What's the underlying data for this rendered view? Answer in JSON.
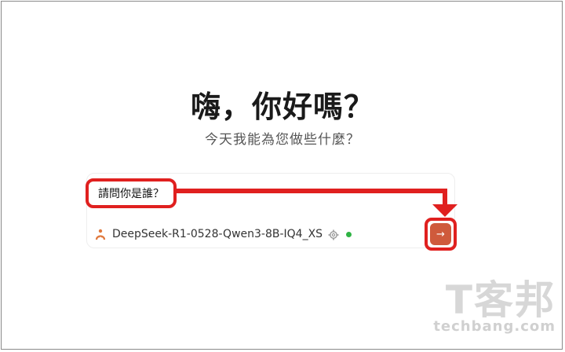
{
  "greeting": {
    "title": "嗨，你好嗎？",
    "subtitle": "今天我能為您做些什麼？"
  },
  "chat": {
    "query_text": "請問你是誰？",
    "model_name": "DeepSeek-R1-0528-Qwen3-8B-IQ4_XS",
    "model_icon": "robot-logo-icon",
    "settings_icon": "gear-icon",
    "send_icon": "arrow-right-icon",
    "send_glyph": "→"
  },
  "watermark": {
    "cjk": "T客邦",
    "url": "techbang.com"
  },
  "colors": {
    "annotation_red": "#e0201f",
    "send_button": "#cf5a3c",
    "status_green": "#2fb344",
    "model_icon": "#e0783c",
    "gear": "#999999"
  }
}
